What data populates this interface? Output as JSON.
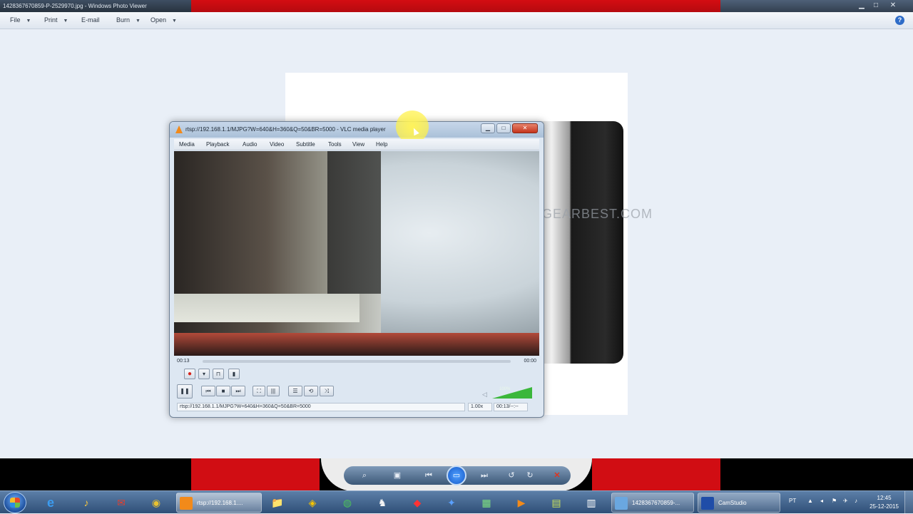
{
  "photo_viewer": {
    "title": "1428367670859-P-2529970.jpg - Windows Photo Viewer",
    "menu": [
      {
        "label": "File",
        "caret": "▼"
      },
      {
        "label": "Print",
        "caret": "▼"
      },
      {
        "label": "E-mail",
        "caret": ""
      },
      {
        "label": "Burn",
        "caret": "▼"
      },
      {
        "label": "Open",
        "caret": "▼"
      }
    ],
    "help": "?",
    "window_controls": {
      "minimize": "▁",
      "maximize": "□",
      "close": "✕"
    },
    "watermark_text": "GEARBEST.COM",
    "controls": {
      "zoom": "⌕",
      "actual_size": "▣",
      "previous": "⏮",
      "slideshow": "▭",
      "next": "⏭",
      "rotate_ccw": "↺",
      "rotate_cw": "↻",
      "delete": "✕"
    }
  },
  "vlc": {
    "title": "rtsp://192.168.1.1/MJPG?W=640&H=360&Q=50&BR=5000 - VLC media player",
    "menu": [
      "Media",
      "Playback",
      "Audio",
      "Video",
      "Subtitle",
      "Tools",
      "View",
      "Help"
    ],
    "time_elapsed": "00:13",
    "time_total": "00:00",
    "volume_label": "100%",
    "volume_level": 1.0,
    "status": {
      "url": "rtsp://192.168.1.1/MJPG?W=640&H=360&Q=50&BR=5000",
      "speed": "1.00x",
      "time": "00:13/--:--"
    },
    "buttons": {
      "record": "●",
      "snapshot": "▾",
      "loop_ab": "⊓",
      "frame_step": "▮",
      "pause": "❚❚",
      "prev": "⏮",
      "stop": "■",
      "next": "⏭",
      "fullscreen": "⛶",
      "ext_settings": "|||",
      "playlist": "☰",
      "loop": "⟲",
      "random": "⤨"
    },
    "window_controls": {
      "minimize": "▁",
      "maximize": "□",
      "close": "✕"
    }
  },
  "taskbar": {
    "tasks": [
      {
        "label": "rtsp://192.168.1....",
        "color": "#f28a1a"
      },
      {
        "label": "1428367670859-...",
        "color": "#6aa7e0"
      },
      {
        "label": "CamStudio",
        "color": "#1f4da8"
      }
    ],
    "pinned": [
      "⊞",
      "e",
      "♪",
      "✉",
      "◉",
      "📁",
      "◈",
      "◍",
      "♞",
      "◆",
      "✦",
      "▦",
      "▶",
      "▤",
      "▥"
    ],
    "tray": {
      "lang": "PT",
      "icons": [
        "▲",
        "◂",
        "⚑",
        "✈",
        "♪"
      ]
    },
    "clock": {
      "time": "12:45",
      "date": "25-12-2015"
    }
  }
}
